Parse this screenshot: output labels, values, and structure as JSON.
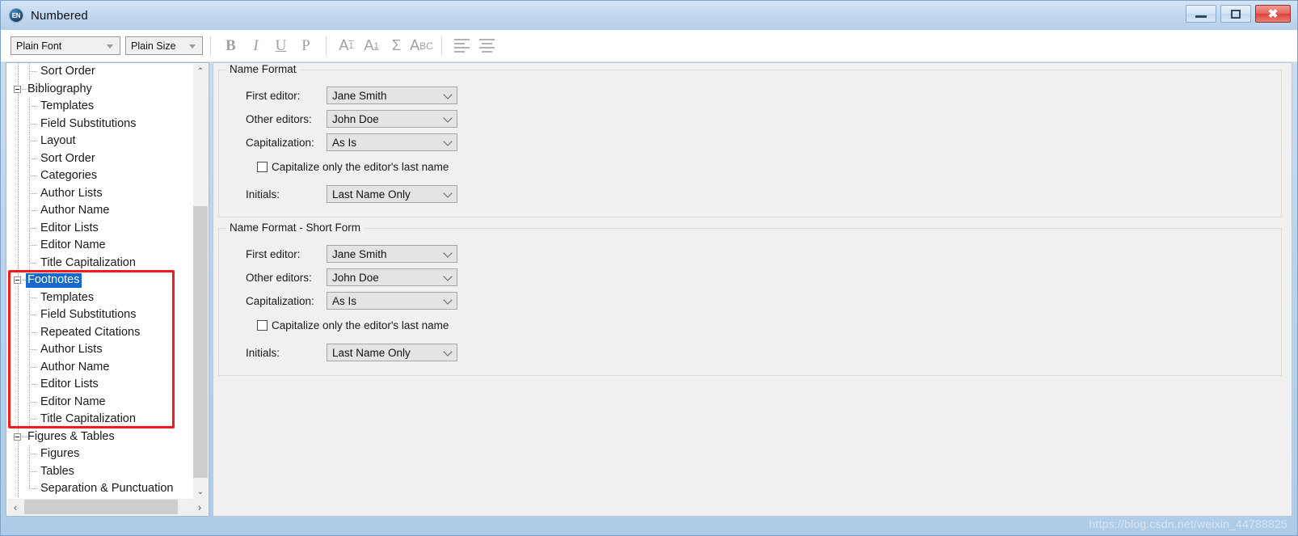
{
  "window": {
    "title": "Numbered",
    "app_icon": "EN",
    "icon_name": "endnote-icon",
    "minimize_label": "Minimize",
    "maximize_label": "Maximize",
    "close_label": "Close"
  },
  "toolbar": {
    "font_combo": "Plain Font",
    "size_combo": "Plain Size",
    "buttons": [
      {
        "name": "bold-button",
        "glyph": "B"
      },
      {
        "name": "italic-button",
        "glyph": "I"
      },
      {
        "name": "underline-button",
        "glyph": "U"
      },
      {
        "name": "plain-button",
        "glyph": "P"
      },
      {
        "name": "superscript-button",
        "glyph": "A1"
      },
      {
        "name": "subscript-button",
        "glyph": "A1"
      },
      {
        "name": "insert-symbol-button",
        "glyph": "Σ"
      },
      {
        "name": "spell-check-button",
        "glyph": "ABC"
      },
      {
        "name": "align-left-button",
        "glyph": "align-left"
      },
      {
        "name": "align-center-button",
        "glyph": "align-center"
      }
    ]
  },
  "tree": {
    "nodes": [
      {
        "label": "Sort Order",
        "depth": 2,
        "type": "leaf",
        "selected": false
      },
      {
        "label": "Bibliography",
        "depth": 1,
        "type": "expanded",
        "selected": false
      },
      {
        "label": "Templates",
        "depth": 2,
        "type": "leaf",
        "selected": false
      },
      {
        "label": "Field Substitutions",
        "depth": 2,
        "type": "leaf",
        "selected": false
      },
      {
        "label": "Layout",
        "depth": 2,
        "type": "leaf",
        "selected": false
      },
      {
        "label": "Sort Order",
        "depth": 2,
        "type": "leaf",
        "selected": false
      },
      {
        "label": "Categories",
        "depth": 2,
        "type": "leaf",
        "selected": false
      },
      {
        "label": "Author Lists",
        "depth": 2,
        "type": "leaf",
        "selected": false
      },
      {
        "label": "Author Name",
        "depth": 2,
        "type": "leaf",
        "selected": false
      },
      {
        "label": "Editor Lists",
        "depth": 2,
        "type": "leaf",
        "selected": false
      },
      {
        "label": "Editor Name",
        "depth": 2,
        "type": "leaf",
        "selected": false
      },
      {
        "label": "Title Capitalization",
        "depth": 2,
        "type": "leaf",
        "selected": false
      },
      {
        "label": "Footnotes",
        "depth": 1,
        "type": "expanded",
        "selected": true
      },
      {
        "label": "Templates",
        "depth": 2,
        "type": "leaf",
        "selected": false
      },
      {
        "label": "Field Substitutions",
        "depth": 2,
        "type": "leaf",
        "selected": false
      },
      {
        "label": "Repeated Citations",
        "depth": 2,
        "type": "leaf",
        "selected": false
      },
      {
        "label": "Author Lists",
        "depth": 2,
        "type": "leaf",
        "selected": false
      },
      {
        "label": "Author Name",
        "depth": 2,
        "type": "leaf",
        "selected": false
      },
      {
        "label": "Editor Lists",
        "depth": 2,
        "type": "leaf",
        "selected": false
      },
      {
        "label": "Editor Name",
        "depth": 2,
        "type": "leaf",
        "selected": false
      },
      {
        "label": "Title Capitalization",
        "depth": 2,
        "type": "leaf",
        "selected": false
      },
      {
        "label": "Figures & Tables",
        "depth": 1,
        "type": "expanded",
        "selected": false
      },
      {
        "label": "Figures",
        "depth": 2,
        "type": "leaf",
        "selected": false
      },
      {
        "label": "Tables",
        "depth": 2,
        "type": "leaf",
        "selected": false
      },
      {
        "label": "Separation & Punctuation",
        "depth": 2,
        "type": "leaf",
        "selected": false
      }
    ],
    "highlight_color": "#f01d1d",
    "selection_color": "#1569c7",
    "scroll_up_glyph": "⌃",
    "scroll_down_glyph": "⌄",
    "scroll_left_glyph": "‹",
    "scroll_right_glyph": "›"
  },
  "panels": [
    {
      "title": "Name Format",
      "fields": [
        {
          "label": "First editor:",
          "value": "Jane Smith"
        },
        {
          "label": "Other editors:",
          "value": "John Doe"
        },
        {
          "label": "Capitalization:",
          "value": "As Is"
        }
      ],
      "checkbox": {
        "label": "Capitalize only the editor's last name",
        "checked": false
      },
      "initials": {
        "label": "Initials:",
        "value": "Last Name Only"
      }
    },
    {
      "title": "Name Format - Short Form",
      "fields": [
        {
          "label": "First editor:",
          "value": "Jane Smith"
        },
        {
          "label": "Other editors:",
          "value": "John Doe"
        },
        {
          "label": "Capitalization:",
          "value": "As Is"
        }
      ],
      "checkbox": {
        "label": "Capitalize only the editor's last name",
        "checked": false
      },
      "initials": {
        "label": "Initials:",
        "value": "Last Name Only"
      }
    }
  ],
  "watermark": "https://blog.csdn.net/weixin_44788825"
}
